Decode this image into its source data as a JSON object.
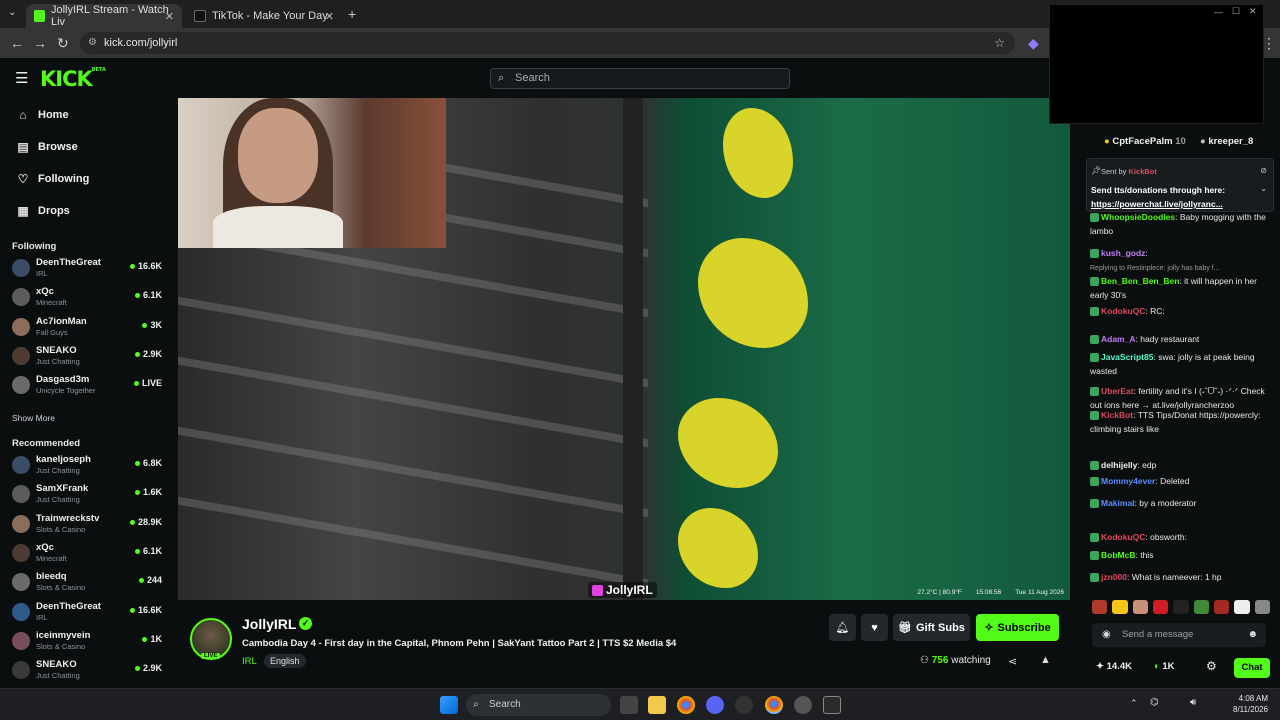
{
  "browser": {
    "tabs": [
      {
        "title": "JollyIRL Stream - Watch Liv"
      },
      {
        "title": "TikTok - Make Your Day"
      }
    ],
    "url": "kick.com/jollyirl"
  },
  "kick": {
    "logo": "KICK",
    "logo_sup": "BETA",
    "search_placeholder": "Search"
  },
  "sidebar": {
    "nav": [
      {
        "label": "Home",
        "icon": "home-icon"
      },
      {
        "label": "Browse",
        "icon": "browse-icon"
      },
      {
        "label": "Following",
        "icon": "heart-icon"
      },
      {
        "label": "Drops",
        "icon": "drops-icon"
      }
    ],
    "following_title": "Following",
    "following": [
      {
        "name": "DeenTheGreat",
        "category": "IRL",
        "viewers": "16.6K"
      },
      {
        "name": "xQc",
        "category": "Minecraft",
        "viewers": "6.1K"
      },
      {
        "name": "Ac7ionMan",
        "category": "Fall Guys",
        "viewers": "3K"
      },
      {
        "name": "SNEAKO",
        "category": "Just Chatting",
        "viewers": "2.9K"
      },
      {
        "name": "Dasgasd3m",
        "category": "Unicycle Together",
        "viewers": "LIVE"
      }
    ],
    "show_more": "Show More",
    "recommended_title": "Recommended",
    "recommended": [
      {
        "name": "kaneljoseph",
        "category": "Just Chatting",
        "viewers": "6.8K"
      },
      {
        "name": "SamXFrank",
        "category": "Just Chatting",
        "viewers": "1.6K"
      },
      {
        "name": "Trainwreckstv",
        "category": "Slots & Casino",
        "viewers": "28.9K"
      },
      {
        "name": "xQc",
        "category": "Minecraft",
        "viewers": "6.1K"
      },
      {
        "name": "bleedq",
        "category": "Slots & Casino",
        "viewers": "244"
      },
      {
        "name": "DeenTheGreat",
        "category": "IRL",
        "viewers": "16.6K"
      },
      {
        "name": "iceinmyvein",
        "category": "Slots & Casino",
        "viewers": "1K"
      },
      {
        "name": "SNEAKO",
        "category": "Just Chatting",
        "viewers": "2.9K"
      }
    ]
  },
  "video": {
    "stats": [
      "27.2°C | 80.9°F",
      "15:08:56",
      "Tue 11 Aug 2026"
    ],
    "watermark": "JollyIRL"
  },
  "stream": {
    "streamer": "JollyIRL",
    "live": "LIVE",
    "title": "Cambodia Day 4 - First day in the Capital, Phnom Pehn | SakYant Tattoo Part 2 | TTS $2 Media $4",
    "category": "IRL",
    "language": "English",
    "gift_subs": "Gift Subs",
    "subscribe": "Subscribe",
    "viewers": "756",
    "watching_label": "watching"
  },
  "chat": {
    "top_users": [
      {
        "name": "CptFacePalm",
        "count": "10"
      },
      {
        "name": "kreeper_8",
        "count": ""
      }
    ],
    "pinned": {
      "sent_by": "Sent by",
      "sender": "KickBot",
      "line1": "Send tts/donations through here:",
      "line2": "https://powerchat.live/jollyranc..."
    },
    "messages": [
      {
        "user": "WhoopsieDoodles",
        "text": "Baby mogging with the lambo",
        "color": "#53fc18"
      },
      {
        "user": "kush_godz",
        "text": "",
        "color": "#c27cf5"
      },
      {
        "user": "Ben_Ben_Ben_Ben",
        "text": "it will happen in her early 30's",
        "color": "#53fc18",
        "reply": "Replying to Restinplece: jolly has baby f..."
      },
      {
        "user": "KodokuQC",
        "text": "RC:",
        "color": "#e0475d"
      },
      {
        "user": "Adam_A",
        "text": "hady restaurant",
        "color": "#c27cf5"
      },
      {
        "user": "JavaScript85",
        "text": "swa: jolly is at peak being wasted",
        "color": "#53fcd2"
      },
      {
        "user": "UberEat",
        "text": "fertility and it's I (˶ˆᗜˆ˵) ·ᐟ·ᐟ Check out ions here → at.live/jollyrancherzoo",
        "color": "#e0475d"
      },
      {
        "user": "KickBot",
        "text": "TTS Tips/Donat https://powercly: climbing stairs like",
        "color": "#e0475d"
      },
      {
        "user": "delhijelly",
        "text": "edp",
        "color": "#f0f0f0"
      },
      {
        "user": "Mommy4ever",
        "text": "Deleted",
        "color": "#5b8dff"
      },
      {
        "user": "Makimal",
        "text": "by a moderator",
        "color": "#5b8dff"
      },
      {
        "user": "KodokuQC",
        "text": "obsworth:",
        "color": "#e0475d"
      },
      {
        "user": "BobMcB",
        "text": "this",
        "color": "#53fc18"
      },
      {
        "user": "jzn000",
        "text": "What is nameever: 1 hp",
        "color": "#e0475d"
      }
    ],
    "input_placeholder": "Send a message",
    "likes": "14.4K",
    "kicks": "1K",
    "chat_button": "Chat"
  },
  "taskbar": {
    "search": "Search",
    "time": "4:08 AM",
    "date": "8/11/2026"
  },
  "colors": {
    "accent": "#53fc18",
    "background": "#0b0e0f"
  }
}
